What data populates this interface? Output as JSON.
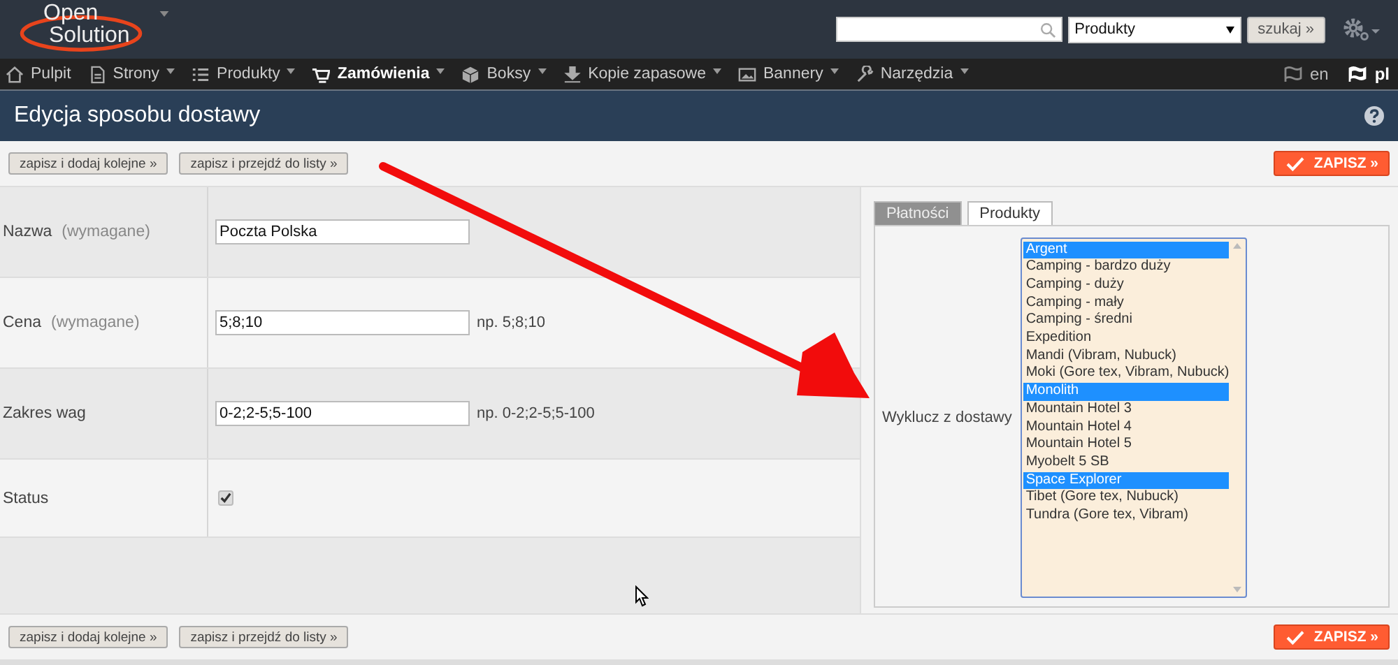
{
  "header": {
    "logo": {
      "line1": "Open",
      "line2": "Solution"
    },
    "search_scope": "Produkty",
    "search_button": "szukaj »"
  },
  "nav": {
    "items": [
      {
        "label": "Pulpit",
        "dropdown": false,
        "selected": false
      },
      {
        "label": "Strony",
        "dropdown": true,
        "selected": false
      },
      {
        "label": "Produkty",
        "dropdown": true,
        "selected": false
      },
      {
        "label": "Zamówienia",
        "dropdown": true,
        "selected": true
      },
      {
        "label": "Boksy",
        "dropdown": true,
        "selected": false
      },
      {
        "label": "Kopie zapasowe",
        "dropdown": true,
        "selected": false
      },
      {
        "label": "Bannery",
        "dropdown": true,
        "selected": false
      },
      {
        "label": "Narzędzia",
        "dropdown": true,
        "selected": false
      }
    ],
    "languages": [
      {
        "label": "en",
        "selected": false
      },
      {
        "label": "pl",
        "selected": true
      }
    ]
  },
  "page_title": "Edycja sposobu dostawy",
  "toolbar_top": {
    "buttons": [
      "zapisz i dodaj kolejne »",
      "zapisz i przejdź do listy »"
    ],
    "save": "ZAPISZ »"
  },
  "form": {
    "fields": [
      {
        "kind": "text",
        "label": "Nazwa",
        "hint": "(wymagane)",
        "value": "Poczta Polska"
      },
      {
        "kind": "text",
        "label": "Cena",
        "hint": "(wymagane)",
        "value": "5;8;10",
        "example": "np. 5;8;10"
      },
      {
        "kind": "text",
        "label": "Zakres wag",
        "value": "0-2;2-5;5-100",
        "example": "np. 0-2;2-5;5-100"
      },
      {
        "kind": "checkbox",
        "label": "Status",
        "checked": true
      }
    ]
  },
  "side_panel": {
    "tabs": [
      {
        "label": "Płatności",
        "selected": false
      },
      {
        "label": "Produkty",
        "selected": true
      }
    ],
    "exclude_label": "Wyklucz z dostawy",
    "options": [
      {
        "label": "Argent",
        "selected": true
      },
      {
        "label": "Camping - bardzo duży",
        "selected": false
      },
      {
        "label": "Camping - duży",
        "selected": false
      },
      {
        "label": "Camping - mały",
        "selected": false
      },
      {
        "label": "Camping - średni",
        "selected": false
      },
      {
        "label": "Expedition",
        "selected": false
      },
      {
        "label": "Mandi (Vibram, Nubuck)",
        "selected": false
      },
      {
        "label": "Moki (Gore tex, Vibram, Nubuck)",
        "selected": false
      },
      {
        "label": "Monolith",
        "selected": true
      },
      {
        "label": "Mountain Hotel 3",
        "selected": false
      },
      {
        "label": "Mountain Hotel 4",
        "selected": false
      },
      {
        "label": "Mountain Hotel 5",
        "selected": false
      },
      {
        "label": "Myobelt 5 SB",
        "selected": false
      },
      {
        "label": "Space Explorer",
        "selected": true
      },
      {
        "label": "Tibet (Gore tex, Nubuck)",
        "selected": false
      },
      {
        "label": "Tundra (Gore tex, Vibram)",
        "selected": false
      }
    ]
  },
  "toolbar_bottom": {
    "buttons": [
      "zapisz i dodaj kolejne »",
      "zapisz i przejdź do listy »"
    ],
    "save": "ZAPISZ »"
  }
}
